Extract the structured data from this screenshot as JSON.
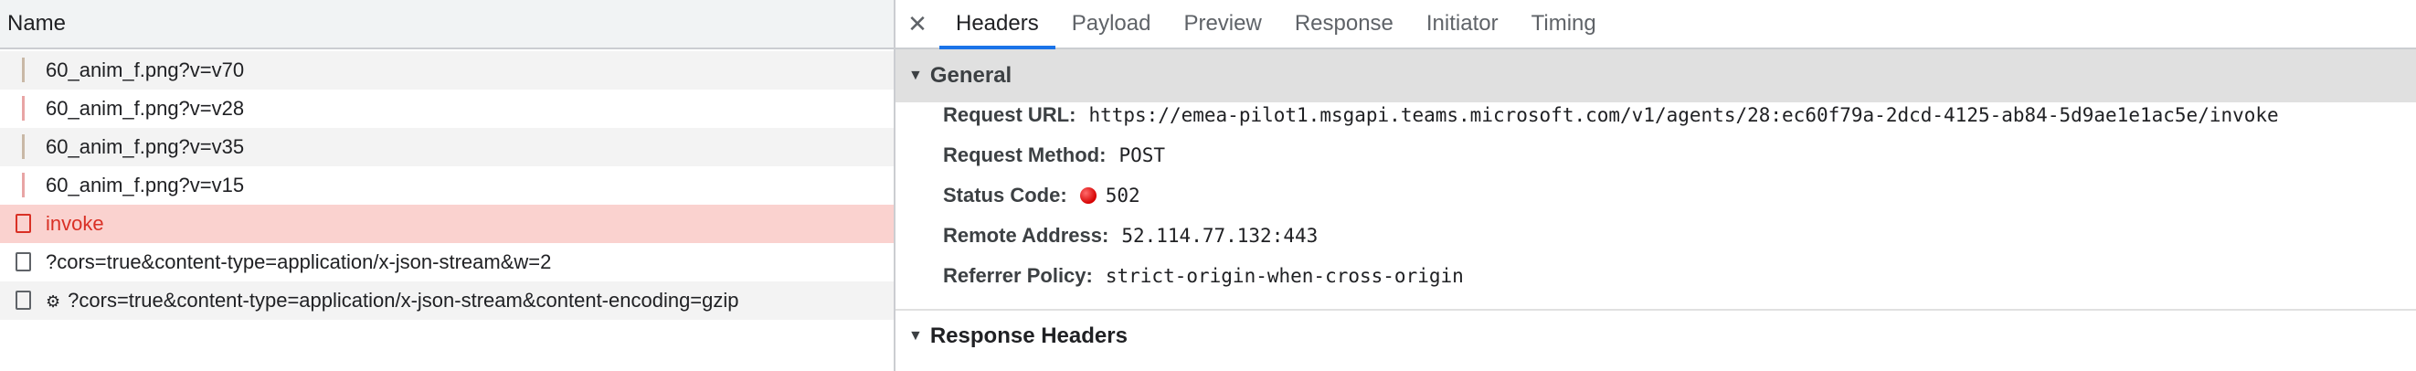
{
  "requests": {
    "column_name": "Name",
    "rows": [
      {
        "name": "60_anim_f.png?v=v70",
        "marker_color": "#c9b8a6"
      },
      {
        "name": "60_anim_f.png?v=v28",
        "marker_color": "#e8a5a5"
      },
      {
        "name": "60_anim_f.png?v=v35",
        "marker_color": "#c9b8a6"
      },
      {
        "name": "60_anim_f.png?v=v15",
        "marker_color": "#e8a5a5"
      },
      {
        "name": "invoke",
        "status": "error"
      },
      {
        "name": "?cors=true&content-type=application/x-json-stream&w=2"
      },
      {
        "name": "?cors=true&content-type=application/x-json-stream&content-encoding=gzip",
        "icon": "gear-icon"
      }
    ]
  },
  "details": {
    "close_icon": "close-icon",
    "tabs": [
      "Headers",
      "Payload",
      "Preview",
      "Response",
      "Initiator",
      "Timing"
    ],
    "active_tab": "Headers",
    "general": {
      "title": "General",
      "fields": [
        {
          "label": "Request URL:",
          "value": "https://emea-pilot1.msgapi.teams.microsoft.com/v1/agents/28:ec60f79a-2dcd-4125-ab84-5d9ae1e1ac5e/invoke"
        },
        {
          "label": "Request Method:",
          "value": "POST"
        },
        {
          "label": "Status Code:",
          "value": "502",
          "status_color": "#d50000"
        },
        {
          "label": "Remote Address:",
          "value": "52.114.77.132:443"
        },
        {
          "label": "Referrer Policy:",
          "value": "strict-origin-when-cross-origin"
        }
      ]
    },
    "response_headers": {
      "title": "Response Headers"
    }
  },
  "colors": {
    "accent": "#1a73e8",
    "error_row": "#fad2cf",
    "error_text": "#d93025"
  }
}
